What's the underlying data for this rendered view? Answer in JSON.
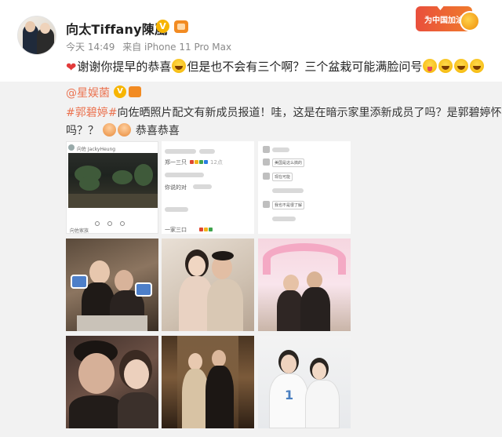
{
  "post": {
    "author": "向太Tiffany陳嵐",
    "verified_badge": "V",
    "meta_time": "今天 14:49",
    "meta_source": "来自 iPhone 11 Pro Max",
    "promo_label": "为中国加油",
    "text_part1": "谢谢你提早的恭喜",
    "text_part2": "但是也不会有三个啊？三个盆栽可能满脸问号"
  },
  "repost": {
    "author": "@星娱菌",
    "verified_badge": "V",
    "hashtag": "#郭碧婷#",
    "line1_text": "向佐晒照片配文有新成员报道！哇，这是在暗示家里添新成员了吗？是郭碧婷怀孕了",
    "line2_text": "吗？？",
    "line2_suffix": "恭喜恭喜"
  },
  "grid": {
    "tile1": {
      "handle": "向佐 JackyHeung",
      "footer": "向佐家族"
    },
    "tile2": {
      "line_a": "郑一三只",
      "count_a": "12点",
      "line_b": "你说的对",
      "line_c": "一家三口"
    },
    "tile3": {
      "bubble_a": "美国是这么搞的",
      "bubble_b": "现在可能",
      "bubble_c": "我也不是很了解"
    }
  },
  "icons": {
    "avatar": "avatar-icon",
    "verified": "verified-icon",
    "member": "member-icon",
    "heart": "heart-icon",
    "promo": "promo-badge-icon"
  },
  "colors": {
    "link": "#eb7350",
    "badge": "#f7b500",
    "repost_bg": "#f2f2f2"
  }
}
